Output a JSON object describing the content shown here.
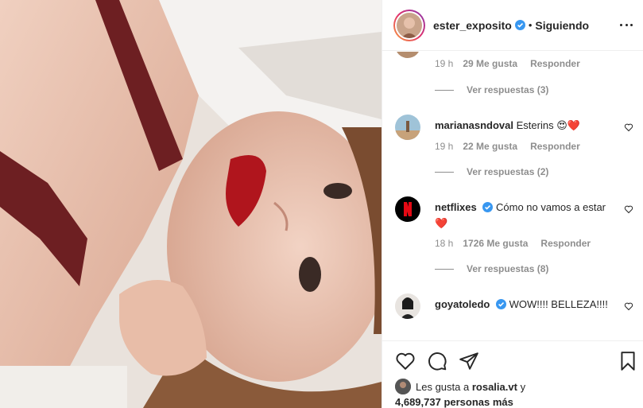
{
  "post": {
    "author": "ester_exposito",
    "separator": "•",
    "follow_status": "Siguiendo"
  },
  "comments": [
    {
      "time": "19 h",
      "likes": "29 Me gusta",
      "reply_label": "Responder",
      "view_replies": "Ver respuestas (3)"
    },
    {
      "username": "marianasndoval",
      "text": "Esterins 😍❤️",
      "time": "19 h",
      "likes": "22 Me gusta",
      "reply_label": "Responder",
      "view_replies": "Ver respuestas (2)"
    },
    {
      "username": "netflixes",
      "text": "Cómo no vamos a estar ❤️",
      "time": "18 h",
      "likes": "1726 Me gusta",
      "reply_label": "Responder",
      "view_replies": "Ver respuestas (8)"
    },
    {
      "username": "goyatoledo",
      "text": "WOW!!!! BELLEZA!!!!"
    }
  ],
  "liked_by": {
    "prefix": "Les gusta a",
    "user": "rosalia.vt",
    "and": "y",
    "others": "4,689,737 personas más"
  },
  "icons": [
    "like-icon",
    "comment-icon",
    "share-icon",
    "save-icon",
    "more-options-icon",
    "verified-icon"
  ],
  "colors": {
    "verified": "#3897f0",
    "text": "#262626",
    "muted": "#8e8e8e",
    "heart": "#ed4956"
  }
}
